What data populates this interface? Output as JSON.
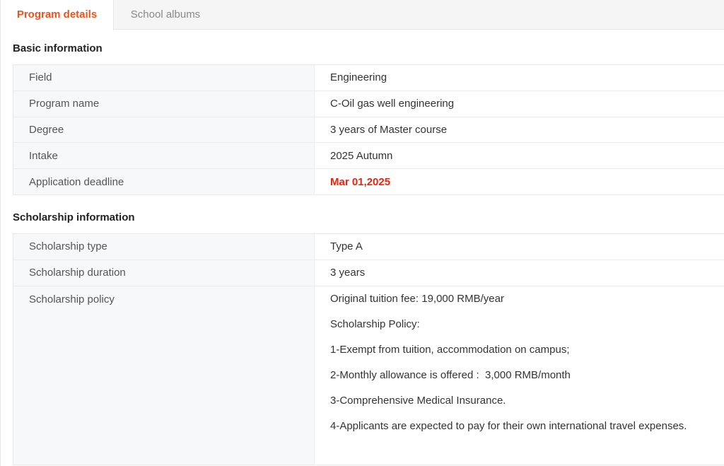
{
  "tabs": [
    {
      "label": "Program details",
      "active": true
    },
    {
      "label": "School albums",
      "active": false
    }
  ],
  "basic_info": {
    "title": "Basic information",
    "rows": [
      {
        "label": "Field",
        "value": "Engineering"
      },
      {
        "label": "Program name",
        "value": "C-Oil gas well engineering"
      },
      {
        "label": "Degree",
        "value": "3 years of Master course"
      },
      {
        "label": "Intake",
        "value": "2025 Autumn"
      },
      {
        "label": "Application deadline",
        "value": "Mar 01,2025"
      }
    ]
  },
  "scholarship_info": {
    "title": "Scholarship information",
    "rows": [
      {
        "label": "Scholarship type",
        "value": "Type A"
      },
      {
        "label": "Scholarship duration",
        "value": "3 years"
      }
    ],
    "policy": {
      "label": "Scholarship policy",
      "lines": [
        "Original tuition fee: 19,000 RMB/year",
        "Scholarship Policy:",
        "1-Exempt from tuition, accommodation on campus;",
        "2-Monthly allowance is offered :  3,000 RMB/month",
        "3-Comprehensive Medical Insurance.",
        "4-Applicants are expected to pay for their own international travel expenses."
      ]
    }
  },
  "colors": {
    "accent": "#e8541e",
    "deadline": "#e8230e",
    "label_bg": "#f7f8f9",
    "tabbar_bg": "#f5f5f5"
  }
}
